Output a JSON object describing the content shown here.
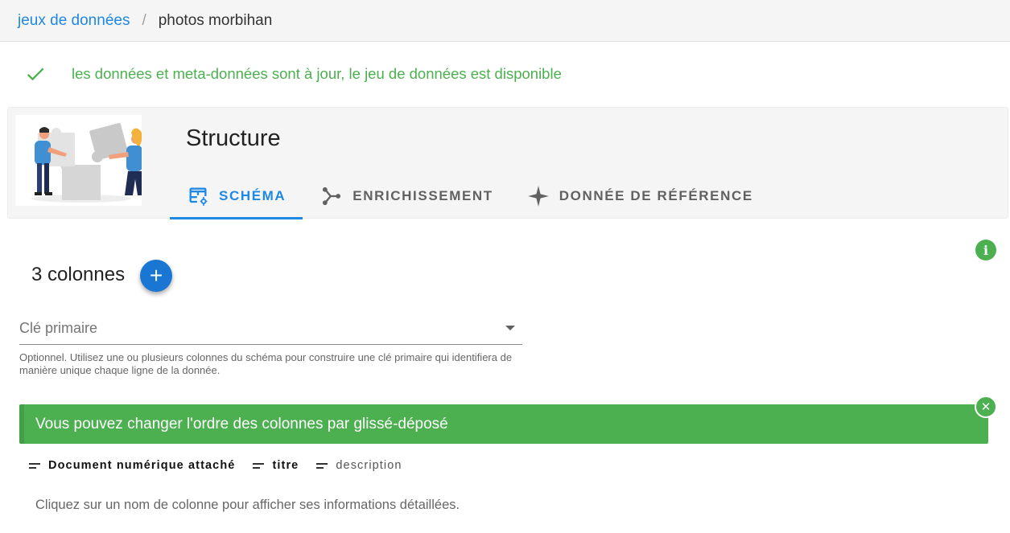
{
  "breadcrumb": {
    "parent": "jeux de données",
    "separator": "/",
    "current": "photos morbihan"
  },
  "status": {
    "message": "les données et meta-données sont à jour, le jeu de données est disponible",
    "color": "#4caf50",
    "icon": "check-icon"
  },
  "structure": {
    "title": "Structure",
    "tabs": [
      {
        "label": "SCHÉMA",
        "icon": "table-settings-icon",
        "active": true
      },
      {
        "label": "ENRICHISSEMENT",
        "icon": "graph-merge-icon",
        "active": false
      },
      {
        "label": "DONNÉE DE RÉFÉRENCE",
        "icon": "star-four-points-icon",
        "active": false
      }
    ]
  },
  "info": {
    "icon": "information-icon",
    "glyph": "i"
  },
  "columns": {
    "heading": "3 colonnes",
    "add_icon": "plus-icon",
    "add_glyph": "+",
    "items": [
      {
        "label": "Document numérique attaché",
        "weight": "bold"
      },
      {
        "label": "titre",
        "weight": "bold"
      },
      {
        "label": "description",
        "weight": "normal"
      }
    ]
  },
  "primary_key": {
    "label": "Clé primaire",
    "hint": "Optionnel. Utilisez une ou plusieurs colonnes du schéma pour construire une clé primaire qui identifiera de manière unique chaque ligne de la donnée."
  },
  "alert": {
    "message": "Vous pouvez changer l'ordre des colonnes par glissé-déposé",
    "close_glyph": "✕",
    "color": "#4caf50"
  },
  "footer_hint": "Cliquez sur un nom de colonne pour afficher ses informations détaillées.",
  "colors": {
    "primary": "#1e88e5",
    "success": "#4caf50"
  }
}
